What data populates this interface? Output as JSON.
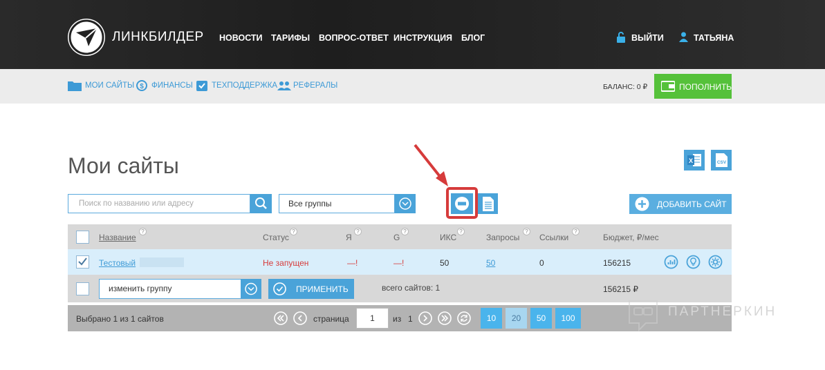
{
  "header": {
    "logo_text": "ЛИНКБИЛДЕР",
    "nav": [
      "НОВОСТИ",
      "ТАРИФЫ",
      "ВОПРОС-ОТВЕТ",
      "ИНСТРУКЦИЯ",
      "БЛОГ"
    ],
    "logout": "ВЫЙТИ",
    "user": "ТАТЬЯНА"
  },
  "subnav": {
    "items": [
      "МОИ САЙТЫ",
      "ФИНАНСЫ",
      "ТЕХПОДДЕРЖКА",
      "РЕФЕРАЛЫ"
    ],
    "balance": "БАЛАНС: 0 ₽",
    "topup": "ПОПОЛНИТЬ"
  },
  "page": {
    "title": "Мои сайты",
    "export_excel": "X",
    "export_csv": "CSV",
    "search_placeholder": "Поиск по названию или адресу",
    "group_select": "Все группы",
    "add_site": "ДОБАВИТЬ САЙТ"
  },
  "table": {
    "columns": [
      "Название",
      "Статус",
      "Я",
      "G",
      "ИКС",
      "Запросы",
      "Ссылки",
      "Бюджет, ₽/мес"
    ],
    "rows": [
      {
        "name": "Тестовый",
        "status": "Не запущен",
        "ya": "—!",
        "g": "—!",
        "iks": "50",
        "requests": "50",
        "links": "0",
        "budget": "156215"
      }
    ],
    "group_action": "изменить группу",
    "apply": "ПРИМЕНИТЬ",
    "total_sites": "всего сайтов: 1",
    "total_budget": "156215 ₽"
  },
  "pager": {
    "selected": "Выбрано 1 из 1 сайтов",
    "page_label": "страница",
    "page_value": "1",
    "of_label": "из",
    "pages_total": "1",
    "per_page": [
      "10",
      "20",
      "50",
      "100"
    ],
    "per_page_active": "20"
  },
  "watermark": "ПАРТНЕРКИН",
  "colors": {
    "accent": "#4aa3d9",
    "green": "#55c13a",
    "red": "#d63b3b",
    "header_bg": "#262626"
  }
}
